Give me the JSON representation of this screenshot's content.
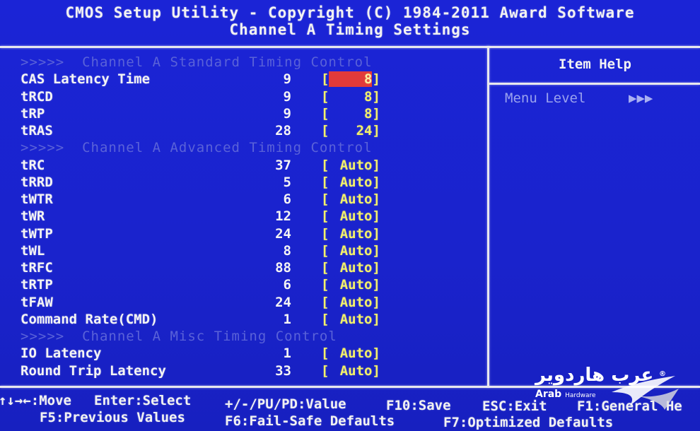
{
  "header": {
    "line1": "CMOS Setup Utility - Copyright (C) 1984-2011 Award Software",
    "line2": "Channel A Timing Settings"
  },
  "rows": [
    {
      "type": "section",
      "label": ">>>>>  Channel A Standard Timing Control"
    },
    {
      "type": "item",
      "label": "CAS Latency Time",
      "current": "9",
      "setting": "8",
      "selected": true
    },
    {
      "type": "item",
      "label": "tRCD",
      "current": "9",
      "setting": "8"
    },
    {
      "type": "item",
      "label": "tRP",
      "current": "9",
      "setting": "8"
    },
    {
      "type": "item",
      "label": "tRAS",
      "current": "28",
      "setting": "24"
    },
    {
      "type": "section",
      "label": ">>>>>  Channel A Advanced Timing Control"
    },
    {
      "type": "item",
      "label": "tRC",
      "current": "37",
      "setting": "Auto"
    },
    {
      "type": "item",
      "label": "tRRD",
      "current": "5",
      "setting": "Auto"
    },
    {
      "type": "item",
      "label": "tWTR",
      "current": "6",
      "setting": "Auto"
    },
    {
      "type": "item",
      "label": "tWR",
      "current": "12",
      "setting": "Auto"
    },
    {
      "type": "item",
      "label": "tWTP",
      "current": "24",
      "setting": "Auto"
    },
    {
      "type": "item",
      "label": "tWL",
      "current": "8",
      "setting": "Auto"
    },
    {
      "type": "item",
      "label": "tRFC",
      "current": "88",
      "setting": "Auto"
    },
    {
      "type": "item",
      "label": "tRTP",
      "current": "6",
      "setting": "Auto"
    },
    {
      "type": "item",
      "label": "tFAW",
      "current": "24",
      "setting": "Auto"
    },
    {
      "type": "item",
      "label": "Command Rate(CMD)",
      "current": "1",
      "setting": "Auto"
    },
    {
      "type": "section",
      "label": ">>>>>  Channel A Misc Timing Control"
    },
    {
      "type": "item",
      "label": "IO Latency",
      "current": "1",
      "setting": "Auto"
    },
    {
      "type": "item",
      "label": "Round Trip Latency",
      "current": "33",
      "setting": "Auto"
    }
  ],
  "help": {
    "title": "Item Help",
    "menu_level_label": "Menu Level",
    "menu_level_value": "▶▶▶"
  },
  "footer": {
    "move": "↑↓→←:Move",
    "enter": "Enter:Select",
    "value": "+/-/PU/PD:Value",
    "f10": "F10:Save",
    "esc": "ESC:Exit",
    "f1": "F1:General He",
    "f5": "F5:Previous Values",
    "f6": "F6:Fail-Safe Defaults",
    "f7": "F7:Optimized Defaults"
  },
  "watermark": {
    "arabic": "عرب هاردوير",
    "english": "Arab",
    "english_small": "Hardware",
    "registered": "®"
  },
  "colors": {
    "background": "#1a22cf",
    "label": "#f4f4f4",
    "setting": "#f3f06a",
    "section": "#5a62d8",
    "highlight": "#e23a3a"
  }
}
